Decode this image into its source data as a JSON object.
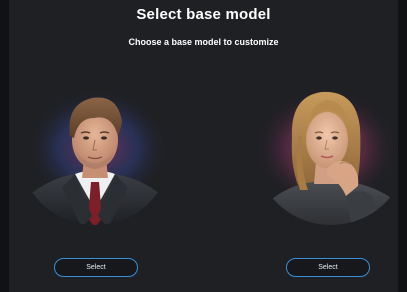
{
  "header": {
    "title": "Select base model",
    "subtitle": "Choose a base model to customize"
  },
  "models": [
    {
      "select_label": "Select"
    },
    {
      "select_label": "Select"
    }
  ]
}
